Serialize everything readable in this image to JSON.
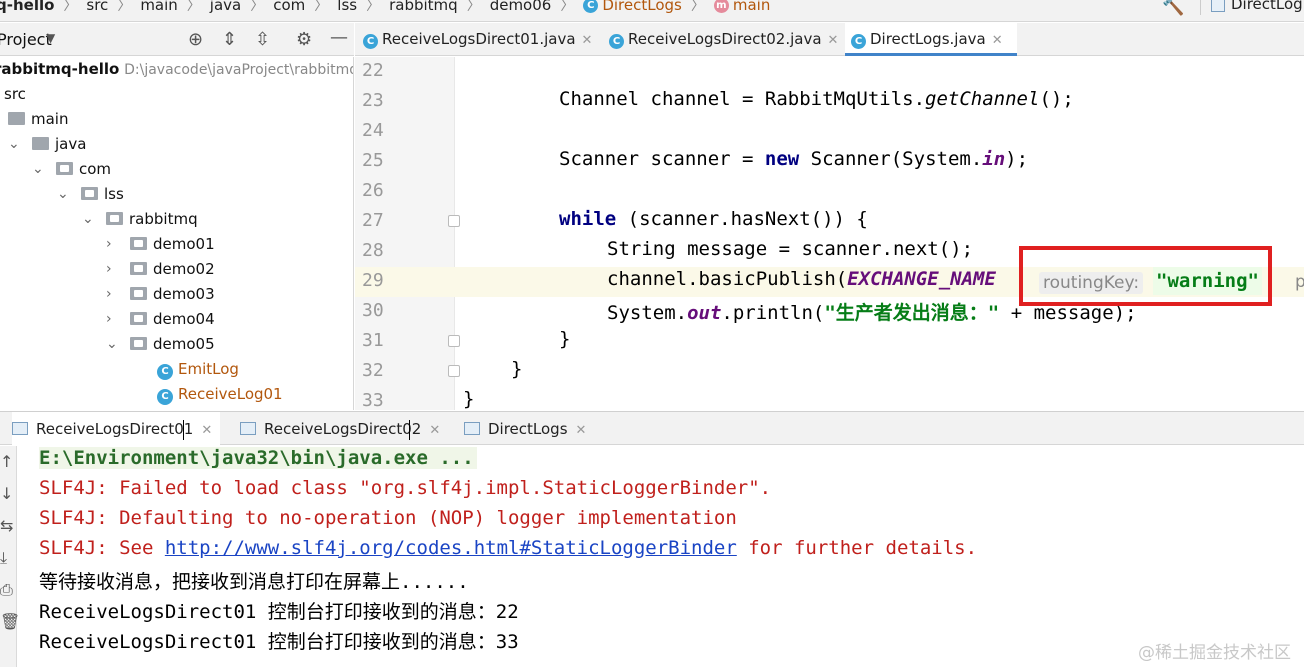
{
  "breadcrumb": {
    "items": [
      "q-hello",
      "src",
      "main",
      "java",
      "com",
      "lss",
      "rabbitmq",
      "demo06",
      "DirectLogs",
      "main"
    ],
    "class_icon": "C",
    "method_icon": "m",
    "run_config": "DirectLog"
  },
  "project_panel": {
    "title": "Project",
    "tree": [
      {
        "label": "rabbitmq-hello",
        "path": "D:\\javacode\\javaProject\\rabbitmq-"
      },
      {
        "label": "src"
      },
      {
        "label": "main"
      },
      {
        "label": "java"
      },
      {
        "label": "com"
      },
      {
        "label": "lss"
      },
      {
        "label": "rabbitmq"
      },
      {
        "label": "demo01"
      },
      {
        "label": "demo02"
      },
      {
        "label": "demo03"
      },
      {
        "label": "demo04"
      },
      {
        "label": "demo05"
      },
      {
        "label": "EmitLog"
      },
      {
        "label": "ReceiveLog01"
      }
    ]
  },
  "editor_tabs": [
    {
      "label": "ReceiveLogsDirect01.java",
      "active": false
    },
    {
      "label": "ReceiveLogsDirect02.java",
      "active": false
    },
    {
      "label": "DirectLogs.java",
      "active": true
    }
  ],
  "editor": {
    "line_numbers": [
      "22",
      "23",
      "24",
      "25",
      "26",
      "27",
      "28",
      "29",
      "30",
      "31",
      "32",
      "33"
    ],
    "current_line": "29",
    "code": {
      "l23_a": "Channel channel = RabbitMqUtils.",
      "l23_b": "getChannel",
      "l23_c": "();",
      "l25_a": "Scanner scanner = ",
      "l25_kw": "new",
      "l25_b": " Scanner(System.",
      "l25_c": "in",
      "l25_d": ");",
      "l27_kw": "while",
      "l27_a": " (scanner.hasNext()) {",
      "l28": "String message = scanner.next();",
      "l29_a": "channel.basicPublish(",
      "l29_b": "EXCHANGE_NAME",
      "l30_a": "System.",
      "l30_b": "out",
      "l30_c": ".println(",
      "l30_str": "\"生产者发出消息：\"",
      "l30_d": " + message);",
      "l31": "}",
      "l32": "}",
      "l33": "}"
    },
    "param_hint_label": "routingKey:",
    "param_hint_value": "\"warning\"",
    "param_hint_next": "p"
  },
  "run_panel": {
    "tabs": [
      {
        "label": "ReceiveLogsDirect01",
        "active": true
      },
      {
        "label": "ReceiveLogsDirect02",
        "active": false
      },
      {
        "label": "DirectLogs",
        "active": false
      }
    ],
    "console": {
      "cmd": "E:\\Environment\\java32\\bin\\java.exe ...",
      "err1": "SLF4J: Failed to load class \"org.slf4j.impl.StaticLoggerBinder\".",
      "err2": "SLF4J: Defaulting to no-operation (NOP) logger implementation",
      "err3_a": "SLF4J: See ",
      "err3_link": "http://www.slf4j.org/codes.html#StaticLoggerBinder",
      "err3_b": " for further details.",
      "out1": "等待接收消息，把接收到消息打印在屏幕上......",
      "out2": "ReceiveLogsDirect01 控制台打印接收到的消息：22",
      "out3": "ReceiveLogsDirect01 控制台打印接收到的消息：33"
    }
  },
  "watermark": "@稀土掘金技术社区",
  "colors": {
    "accent": "#4083c9",
    "highlight_box": "#e02020",
    "string": "#067d17",
    "keyword": "#000080",
    "error": "#c0201c"
  }
}
